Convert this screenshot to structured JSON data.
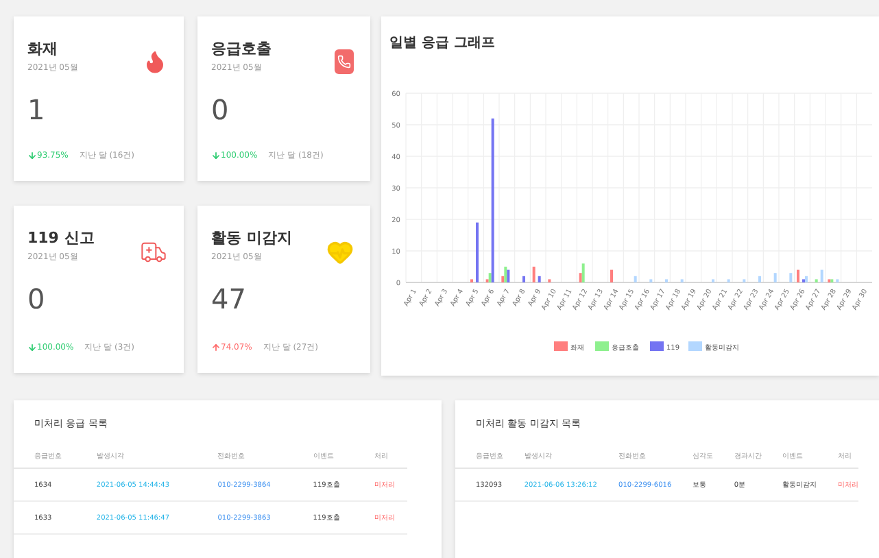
{
  "cards": [
    {
      "kind": "fire",
      "title": "화재",
      "period": "2021년 05월",
      "count": "1",
      "rising": false,
      "change": "93.75%",
      "previous": "지난 달 (16건)"
    },
    {
      "kind": "call",
      "title": "응급호출",
      "period": "2021년 05월",
      "count": "0",
      "rising": false,
      "change": "100.00%",
      "previous": "지난 달 (18건)"
    },
    {
      "kind": "ambulance",
      "title": "119 신고",
      "period": "2021년 05월",
      "count": "0",
      "rising": false,
      "change": "100.00%",
      "previous": "지난 달 (3건)"
    },
    {
      "kind": "activity",
      "title": "활동 미감지",
      "period": "2021년 05월",
      "count": "47",
      "rising": true,
      "change": "74.07%",
      "previous": "지난 달 (27건)"
    }
  ],
  "chart": {
    "title": "일별 응급 그래프",
    "chart_data": {
      "type": "bar",
      "categories": [
        "Apr 1",
        "Apr 2",
        "Apr 3",
        "Apr 4",
        "Apr 5",
        "Apr 6",
        "Apr 7",
        "Apr 8",
        "Apr 9",
        "Apr 10",
        "Apr 11",
        "Apr 12",
        "Apr 13",
        "Apr 14",
        "Apr 15",
        "Apr 16",
        "Apr 17",
        "Apr 18",
        "Apr 19",
        "Apr 20",
        "Apr 21",
        "Apr 22",
        "Apr 23",
        "Apr 24",
        "Apr 25",
        "Apr 26",
        "Apr 27",
        "Apr 28",
        "Apr 29",
        "Apr 30"
      ],
      "series": [
        {
          "name": "화재",
          "color": "#ff7f7f",
          "values": [
            0,
            0,
            0,
            0,
            1,
            1,
            2,
            0,
            5,
            1,
            0,
            3,
            0,
            4,
            0,
            0,
            0,
            0,
            0,
            0,
            0,
            0,
            0,
            0,
            0,
            4,
            0,
            1,
            0,
            0
          ]
        },
        {
          "name": "응급호출",
          "color": "#8ef08e",
          "values": [
            0,
            0,
            0,
            0,
            0,
            3,
            5,
            0,
            0,
            0,
            0,
            6,
            0,
            0,
            0,
            0,
            0,
            0,
            0,
            0,
            0,
            0,
            0,
            0,
            0,
            0,
            1,
            1,
            0,
            0
          ]
        },
        {
          "name": "119",
          "color": "#7474f2",
          "values": [
            0,
            0,
            0,
            0,
            19,
            52,
            4,
            2,
            2,
            0,
            0,
            0,
            0,
            0,
            0,
            0,
            0,
            0,
            0,
            0,
            0,
            0,
            0,
            0,
            0,
            1,
            0,
            0,
            0,
            0
          ]
        },
        {
          "name": "활동미감지",
          "color": "#b3d7ff",
          "values": [
            0,
            0,
            0,
            0,
            0,
            0,
            0,
            0,
            0,
            0,
            0,
            0,
            0,
            0,
            2,
            1,
            1,
            1,
            0,
            1,
            1,
            1,
            2,
            3,
            3,
            2,
            4,
            1,
            0,
            0
          ]
        }
      ],
      "grid": true,
      "legend": true,
      "ylim": [
        0,
        60
      ],
      "yticks": [
        0,
        10,
        20,
        30,
        40,
        50,
        60
      ]
    }
  },
  "tables": [
    {
      "title": "미처리 응급 목록",
      "columns": [
        "응급번호",
        "발생시각",
        "전화번호",
        "이벤트",
        "처리"
      ],
      "rows": [
        [
          "1634",
          "2021-06-05 14:44:43",
          "010-2299-3864",
          "119호출",
          "미처리"
        ],
        [
          "1633",
          "2021-06-05 11:46:47",
          "010-2299-3863",
          "119호출",
          "미처리"
        ]
      ]
    },
    {
      "title": "미처리 활동 미감지 목록",
      "columns": [
        "응급번호",
        "발생시각",
        "전화번호",
        "심각도",
        "경과시간",
        "이벤트",
        "처리"
      ],
      "rows": [
        [
          "132093",
          "2021-06-06 13:26:12",
          "010-2299-6016",
          "보통",
          "0분",
          "활동미감지",
          "미처리"
        ]
      ]
    }
  ]
}
